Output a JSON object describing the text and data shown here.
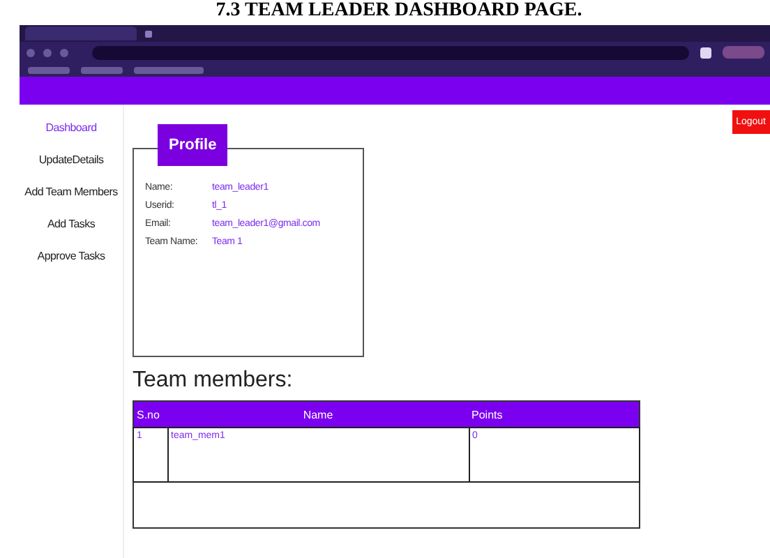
{
  "caption": "7.3 TEAM LEADER DASHBOARD PAGE.",
  "header": {
    "logout": "Logout"
  },
  "sidebar": {
    "items": [
      {
        "label": "Dashboard",
        "selected": true
      },
      {
        "label": "UpdateDetails",
        "selected": false
      },
      {
        "label": "Add Team Members",
        "selected": false
      },
      {
        "label": "Add Tasks",
        "selected": false
      },
      {
        "label": "Approve Tasks",
        "selected": false
      }
    ]
  },
  "profile": {
    "title": "Profile",
    "fields": [
      {
        "label": "Name:",
        "value": "team_leader1"
      },
      {
        "label": "Userid:",
        "value": "tl_1"
      },
      {
        "label": "Email:",
        "value": "team_leader1@gmail.com"
      },
      {
        "label": "Team Name:",
        "value": "Team 1"
      }
    ]
  },
  "team": {
    "heading": "Team members:",
    "columns": [
      "S.no",
      "Name",
      "Points"
    ],
    "rows": [
      [
        "1",
        "team_mem1",
        "0"
      ]
    ]
  }
}
